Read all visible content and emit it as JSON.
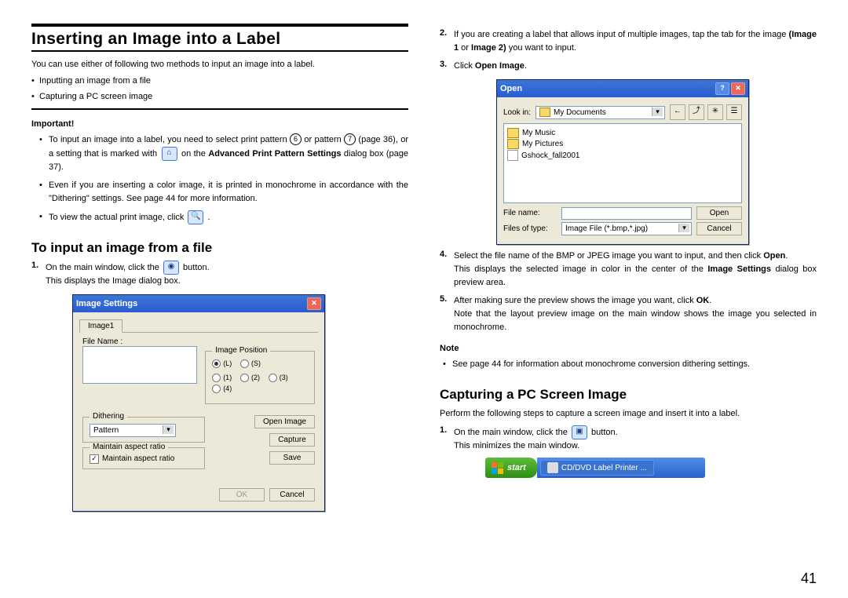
{
  "page_number": "41",
  "left": {
    "h1": "Inserting an Image into a Label",
    "intro": "You can use either of following two methods to input an image into a label.",
    "methods": [
      "Inputting an image from a file",
      "Capturing a PC screen image"
    ],
    "important_label": "Important!",
    "important": [
      {
        "pre": "To input an image into a label, you need to select print pattern ",
        "circ1": "6",
        "mid1": " or pattern ",
        "circ2": "7",
        "mid2": " (page 36), or a setting that is marked with ",
        "icon_name": "camera-icon",
        "post": " on the ",
        "bold": "Advanced Print Pattern Settings",
        "tail": " dialog box (page 37)."
      },
      {
        "pre": "Even if you are inserting a color image, it is printed in monochrome in accordance with the \"Dithering\" settings. See page 44 for more information."
      },
      {
        "pre": "To view the actual print image, click ",
        "icon_name": "magnifier-icon",
        "post": " ."
      }
    ],
    "h2": "To input an image from a file",
    "steps": [
      {
        "num": "1.",
        "pre": "On the main window, click the ",
        "icon_name": "camera-button-icon",
        "mid": " button.",
        "post": " This displays the Image dialog box."
      }
    ],
    "image_settings_dialog": {
      "title": "Image Settings",
      "tab": "Image1",
      "file_name_label": "File Name :",
      "group_position": "Image Position",
      "radios": [
        "(L)",
        "(S)",
        "(1)",
        "(2)",
        "(3)",
        "(4)"
      ],
      "group_dither": "Dithering",
      "dither_value": "Pattern",
      "group_aspect": "Maintain aspect ratio",
      "chk_aspect": "Maintain aspect ratio",
      "btn_open": "Open Image",
      "btn_capture": "Capture",
      "btn_save": "Save",
      "btn_ok": "OK",
      "btn_cancel": "Cancel"
    }
  },
  "right": {
    "step2": {
      "num": "2.",
      "txt_a": "If you are creating a label that allows input of multiple images, tap the tab for the image ",
      "bold1": "(Image 1",
      "or": " or ",
      "bold2": "Image 2)",
      "txt_b": " you want to input."
    },
    "step3": {
      "num": "3.",
      "pre": "Click ",
      "bold": "Open Image",
      "post": "."
    },
    "open_dialog": {
      "title": "Open",
      "lookin_label": "Look in:",
      "lookin_value": "My Documents",
      "files": [
        "My Music",
        "My Pictures",
        "Gshock_fall2001"
      ],
      "filename_label": "File name:",
      "filetype_label": "Files of type:",
      "filetype_value": "Image File (*.bmp,*.jpg)",
      "btn_open": "Open",
      "btn_cancel": "Cancel"
    },
    "step4": {
      "num": "4.",
      "txt_a": "Select the file name of the BMP or JPEG image you want to input, and then click ",
      "bold": "Open",
      "txt_b": ".",
      "txt_c": "This displays the selected image in color in the center of the ",
      "bold2": "Image Settings",
      "txt_d": " dialog box preview area."
    },
    "step5": {
      "num": "5.",
      "txt_a": "After making sure the preview shows the image you want, click ",
      "bold": "OK",
      "txt_b": ".",
      "txt_c": "Note that the layout preview image on the main window shows the image you selected in monochrome."
    },
    "note_label": "Note",
    "note_item": "See page 44 for information about monochrome conversion dithering settings.",
    "h2": "Capturing a PC Screen Image",
    "intro": "Perform the following steps to capture a screen image and insert it into a label.",
    "step1b": {
      "num": "1.",
      "pre": "On the main window, click the ",
      "icon_name": "capture-button-icon",
      "mid": " button.",
      "post": " This minimizes the main window."
    },
    "taskbar": {
      "start": "start",
      "app": "CD/DVD Label Printer ..."
    }
  }
}
